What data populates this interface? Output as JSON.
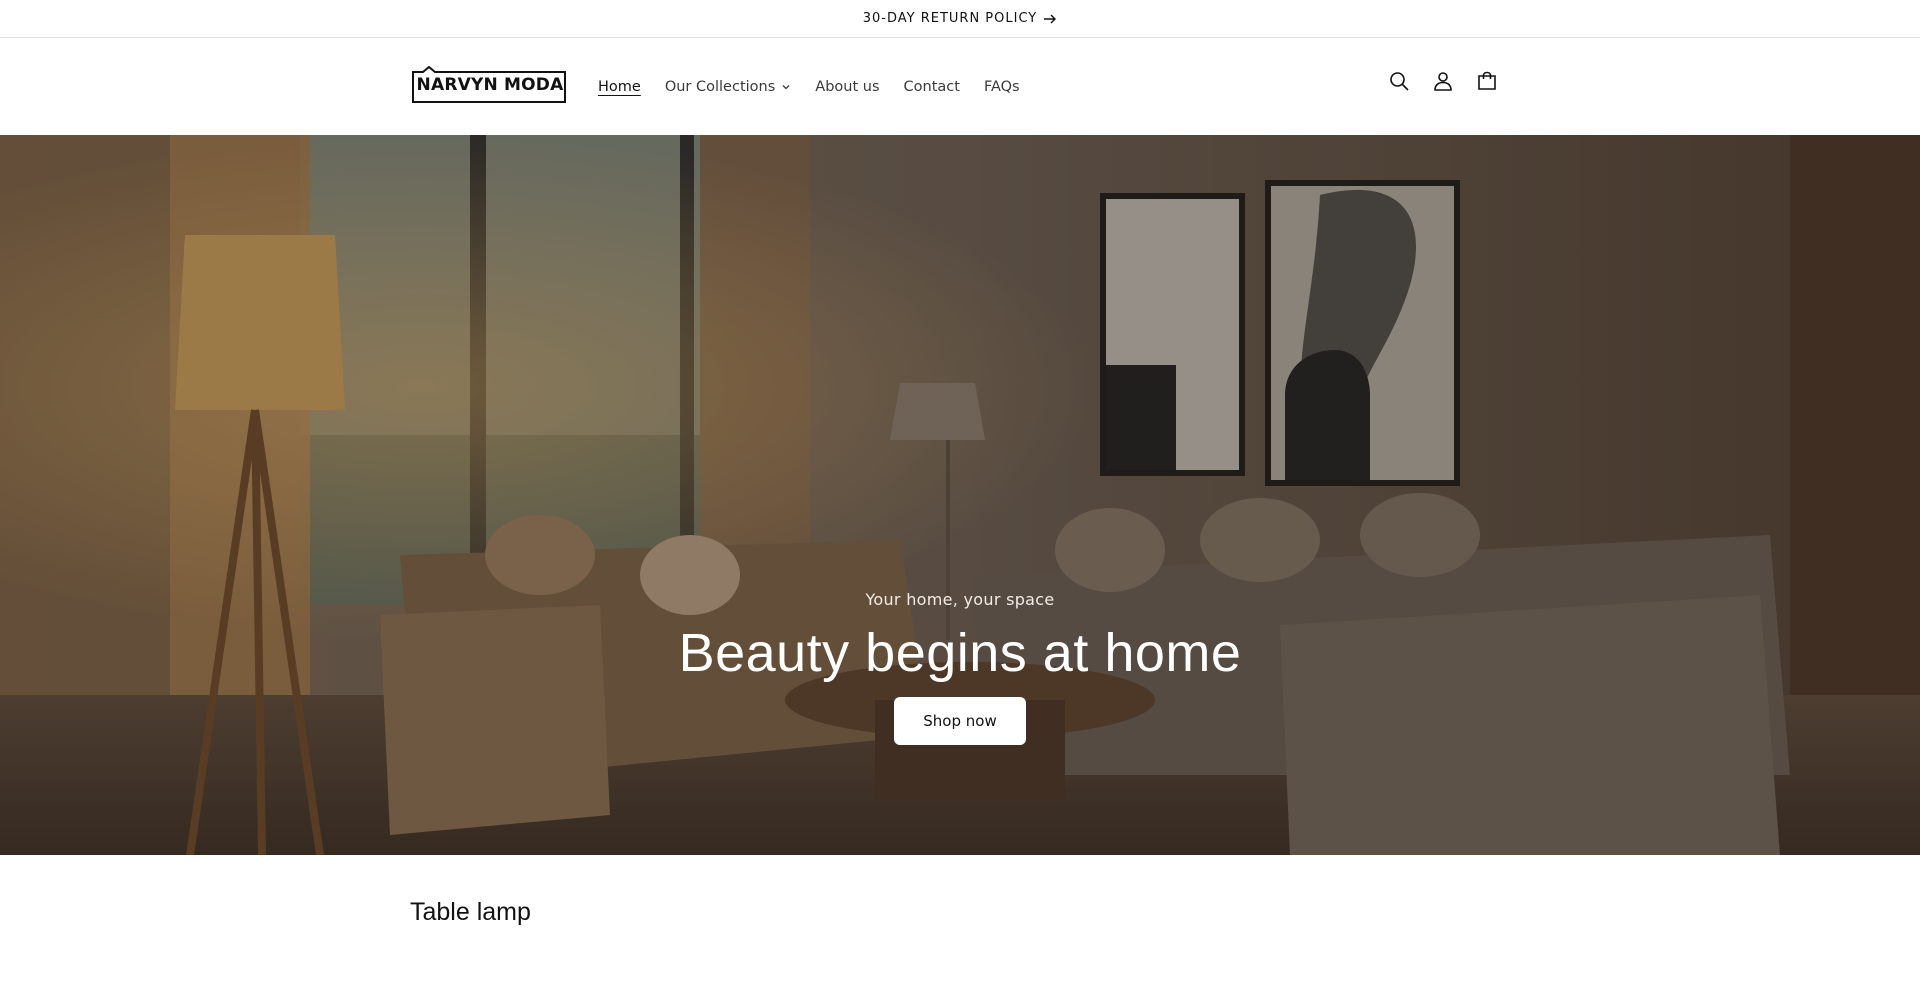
{
  "announcement": {
    "text": "30-DAY RETURN POLICY",
    "icon": "arrow-right-icon"
  },
  "header": {
    "logo_text": "NARVYN MODA",
    "nav": [
      {
        "label": "Home",
        "active": true
      },
      {
        "label": "Our Collections",
        "has_dropdown": true
      },
      {
        "label": "About us"
      },
      {
        "label": "Contact"
      },
      {
        "label": "FAQs"
      }
    ],
    "icons": [
      "search-icon",
      "account-icon",
      "cart-icon"
    ]
  },
  "hero": {
    "subheading": "Your home, your space",
    "heading": "Beauty begins at home",
    "button_label": "Shop now"
  },
  "section": {
    "title": "Table lamp"
  },
  "colors": {
    "text": "#121212",
    "background": "#ffffff",
    "button_bg": "#ffffff"
  }
}
